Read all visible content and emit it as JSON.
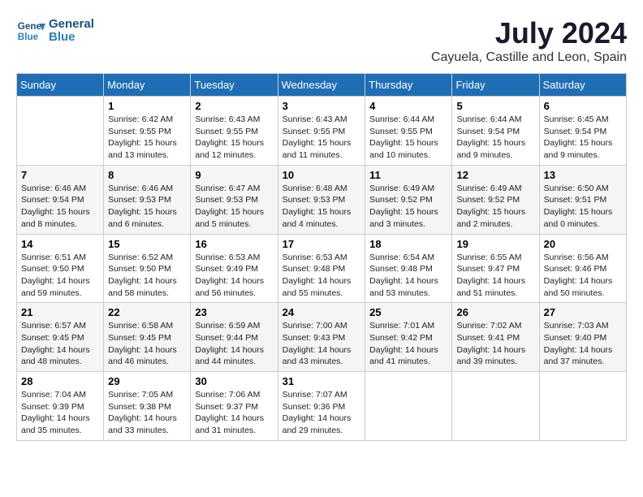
{
  "header": {
    "logo_line1": "General",
    "logo_line2": "Blue",
    "month_title": "July 2024",
    "location": "Cayuela, Castille and Leon, Spain"
  },
  "days_of_week": [
    "Sunday",
    "Monday",
    "Tuesday",
    "Wednesday",
    "Thursday",
    "Friday",
    "Saturday"
  ],
  "weeks": [
    [
      {
        "day": "",
        "text": ""
      },
      {
        "day": "1",
        "text": "Sunrise: 6:42 AM\nSunset: 9:55 PM\nDaylight: 15 hours\nand 13 minutes."
      },
      {
        "day": "2",
        "text": "Sunrise: 6:43 AM\nSunset: 9:55 PM\nDaylight: 15 hours\nand 12 minutes."
      },
      {
        "day": "3",
        "text": "Sunrise: 6:43 AM\nSunset: 9:55 PM\nDaylight: 15 hours\nand 11 minutes."
      },
      {
        "day": "4",
        "text": "Sunrise: 6:44 AM\nSunset: 9:55 PM\nDaylight: 15 hours\nand 10 minutes."
      },
      {
        "day": "5",
        "text": "Sunrise: 6:44 AM\nSunset: 9:54 PM\nDaylight: 15 hours\nand 9 minutes."
      },
      {
        "day": "6",
        "text": "Sunrise: 6:45 AM\nSunset: 9:54 PM\nDaylight: 15 hours\nand 9 minutes."
      }
    ],
    [
      {
        "day": "7",
        "text": "Sunrise: 6:46 AM\nSunset: 9:54 PM\nDaylight: 15 hours\nand 8 minutes."
      },
      {
        "day": "8",
        "text": "Sunrise: 6:46 AM\nSunset: 9:53 PM\nDaylight: 15 hours\nand 6 minutes."
      },
      {
        "day": "9",
        "text": "Sunrise: 6:47 AM\nSunset: 9:53 PM\nDaylight: 15 hours\nand 5 minutes."
      },
      {
        "day": "10",
        "text": "Sunrise: 6:48 AM\nSunset: 9:53 PM\nDaylight: 15 hours\nand 4 minutes."
      },
      {
        "day": "11",
        "text": "Sunrise: 6:49 AM\nSunset: 9:52 PM\nDaylight: 15 hours\nand 3 minutes."
      },
      {
        "day": "12",
        "text": "Sunrise: 6:49 AM\nSunset: 9:52 PM\nDaylight: 15 hours\nand 2 minutes."
      },
      {
        "day": "13",
        "text": "Sunrise: 6:50 AM\nSunset: 9:51 PM\nDaylight: 15 hours\nand 0 minutes."
      }
    ],
    [
      {
        "day": "14",
        "text": "Sunrise: 6:51 AM\nSunset: 9:50 PM\nDaylight: 14 hours\nand 59 minutes."
      },
      {
        "day": "15",
        "text": "Sunrise: 6:52 AM\nSunset: 9:50 PM\nDaylight: 14 hours\nand 58 minutes."
      },
      {
        "day": "16",
        "text": "Sunrise: 6:53 AM\nSunset: 9:49 PM\nDaylight: 14 hours\nand 56 minutes."
      },
      {
        "day": "17",
        "text": "Sunrise: 6:53 AM\nSunset: 9:48 PM\nDaylight: 14 hours\nand 55 minutes."
      },
      {
        "day": "18",
        "text": "Sunrise: 6:54 AM\nSunset: 9:48 PM\nDaylight: 14 hours\nand 53 minutes."
      },
      {
        "day": "19",
        "text": "Sunrise: 6:55 AM\nSunset: 9:47 PM\nDaylight: 14 hours\nand 51 minutes."
      },
      {
        "day": "20",
        "text": "Sunrise: 6:56 AM\nSunset: 9:46 PM\nDaylight: 14 hours\nand 50 minutes."
      }
    ],
    [
      {
        "day": "21",
        "text": "Sunrise: 6:57 AM\nSunset: 9:45 PM\nDaylight: 14 hours\nand 48 minutes."
      },
      {
        "day": "22",
        "text": "Sunrise: 6:58 AM\nSunset: 9:45 PM\nDaylight: 14 hours\nand 46 minutes."
      },
      {
        "day": "23",
        "text": "Sunrise: 6:59 AM\nSunset: 9:44 PM\nDaylight: 14 hours\nand 44 minutes."
      },
      {
        "day": "24",
        "text": "Sunrise: 7:00 AM\nSunset: 9:43 PM\nDaylight: 14 hours\nand 43 minutes."
      },
      {
        "day": "25",
        "text": "Sunrise: 7:01 AM\nSunset: 9:42 PM\nDaylight: 14 hours\nand 41 minutes."
      },
      {
        "day": "26",
        "text": "Sunrise: 7:02 AM\nSunset: 9:41 PM\nDaylight: 14 hours\nand 39 minutes."
      },
      {
        "day": "27",
        "text": "Sunrise: 7:03 AM\nSunset: 9:40 PM\nDaylight: 14 hours\nand 37 minutes."
      }
    ],
    [
      {
        "day": "28",
        "text": "Sunrise: 7:04 AM\nSunset: 9:39 PM\nDaylight: 14 hours\nand 35 minutes."
      },
      {
        "day": "29",
        "text": "Sunrise: 7:05 AM\nSunset: 9:38 PM\nDaylight: 14 hours\nand 33 minutes."
      },
      {
        "day": "30",
        "text": "Sunrise: 7:06 AM\nSunset: 9:37 PM\nDaylight: 14 hours\nand 31 minutes."
      },
      {
        "day": "31",
        "text": "Sunrise: 7:07 AM\nSunset: 9:36 PM\nDaylight: 14 hours\nand 29 minutes."
      },
      {
        "day": "",
        "text": ""
      },
      {
        "day": "",
        "text": ""
      },
      {
        "day": "",
        "text": ""
      }
    ]
  ]
}
